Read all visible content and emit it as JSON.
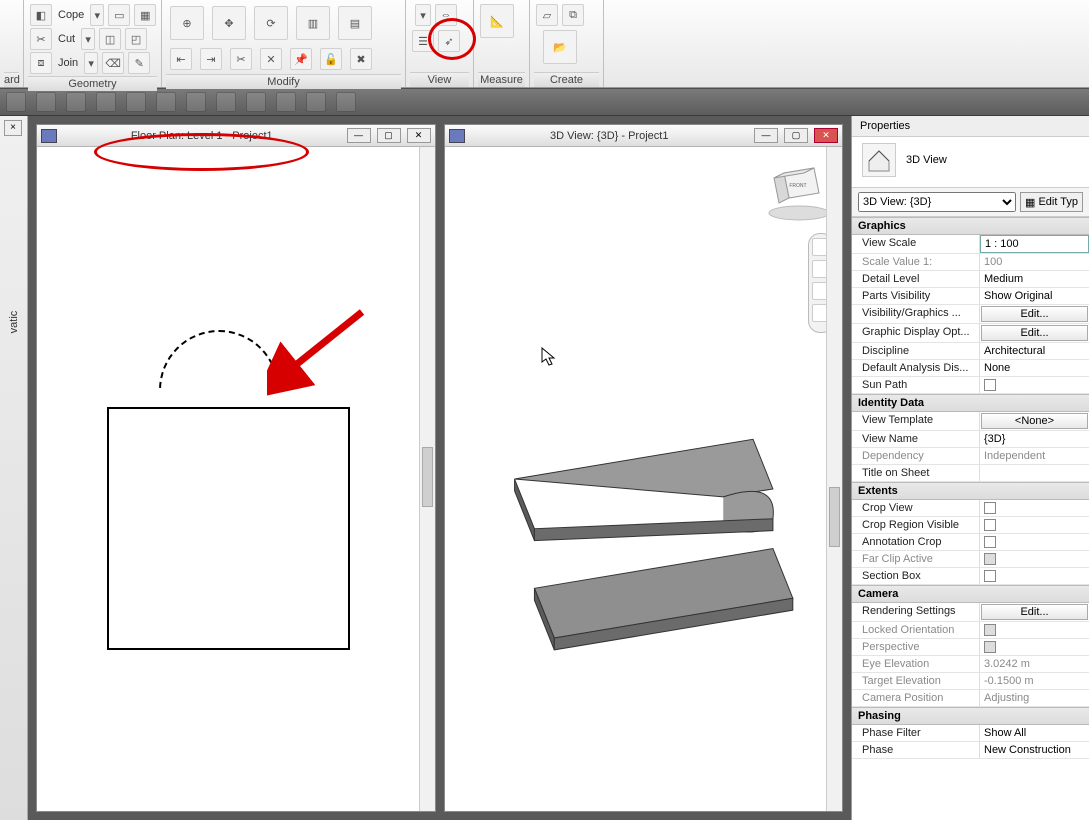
{
  "ribbon": {
    "groups": {
      "ard": "ard",
      "geometry": "Geometry",
      "modify": "Modify",
      "view": "View",
      "measure": "Measure",
      "create": "Create"
    },
    "geometry_items": {
      "cope": "Cope",
      "cut": "Cut",
      "join": "Join"
    },
    "view_tooltip": "View"
  },
  "views": {
    "floor_title": "Floor Plan: Level 1 - Project1",
    "threed_title": "3D View: {3D} - Project1"
  },
  "left_label": "vatic",
  "palette": {
    "title": "Properties",
    "type_name": "3D View",
    "selector": "3D View: {3D}",
    "edit_type": "Edit Typ",
    "groups": {
      "graphics": "Graphics",
      "identity": "Identity Data",
      "extents": "Extents",
      "camera": "Camera",
      "phasing": "Phasing"
    },
    "rows": {
      "view_scale": {
        "k": "View Scale",
        "v": "1 : 100"
      },
      "scale_value": {
        "k": "Scale Value    1:",
        "v": "100"
      },
      "detail_level": {
        "k": "Detail Level",
        "v": "Medium"
      },
      "parts_vis": {
        "k": "Parts Visibility",
        "v": "Show Original"
      },
      "vis_graphics": {
        "k": "Visibility/Graphics ...",
        "v": "Edit..."
      },
      "graphic_disp": {
        "k": "Graphic Display Opt...",
        "v": "Edit..."
      },
      "discipline": {
        "k": "Discipline",
        "v": "Architectural"
      },
      "default_analysis": {
        "k": "Default Analysis Dis...",
        "v": "None"
      },
      "sun_path": {
        "k": "Sun Path",
        "v": ""
      },
      "view_template": {
        "k": "View Template",
        "v": "<None>"
      },
      "view_name": {
        "k": "View Name",
        "v": "{3D}"
      },
      "dependency": {
        "k": "Dependency",
        "v": "Independent"
      },
      "title_on_sheet": {
        "k": "Title on Sheet",
        "v": ""
      },
      "crop_view": {
        "k": "Crop View",
        "v": ""
      },
      "crop_region": {
        "k": "Crop Region Visible",
        "v": ""
      },
      "annotation_crop": {
        "k": "Annotation Crop",
        "v": ""
      },
      "far_clip": {
        "k": "Far Clip Active",
        "v": ""
      },
      "section_box": {
        "k": "Section Box",
        "v": ""
      },
      "rendering": {
        "k": "Rendering Settings",
        "v": "Edit..."
      },
      "locked_orient": {
        "k": "Locked Orientation",
        "v": ""
      },
      "perspective": {
        "k": "Perspective",
        "v": ""
      },
      "eye_elev": {
        "k": "Eye Elevation",
        "v": "3.0242 m"
      },
      "target_elev": {
        "k": "Target Elevation",
        "v": "-0.1500 m"
      },
      "camera_pos": {
        "k": "Camera Position",
        "v": "Adjusting"
      },
      "phase_filter": {
        "k": "Phase Filter",
        "v": "Show All"
      },
      "phase": {
        "k": "Phase",
        "v": "New Construction"
      }
    }
  },
  "icons": {
    "house": "🏠",
    "pencil": "✎",
    "viewcube_face": "FRONT"
  }
}
